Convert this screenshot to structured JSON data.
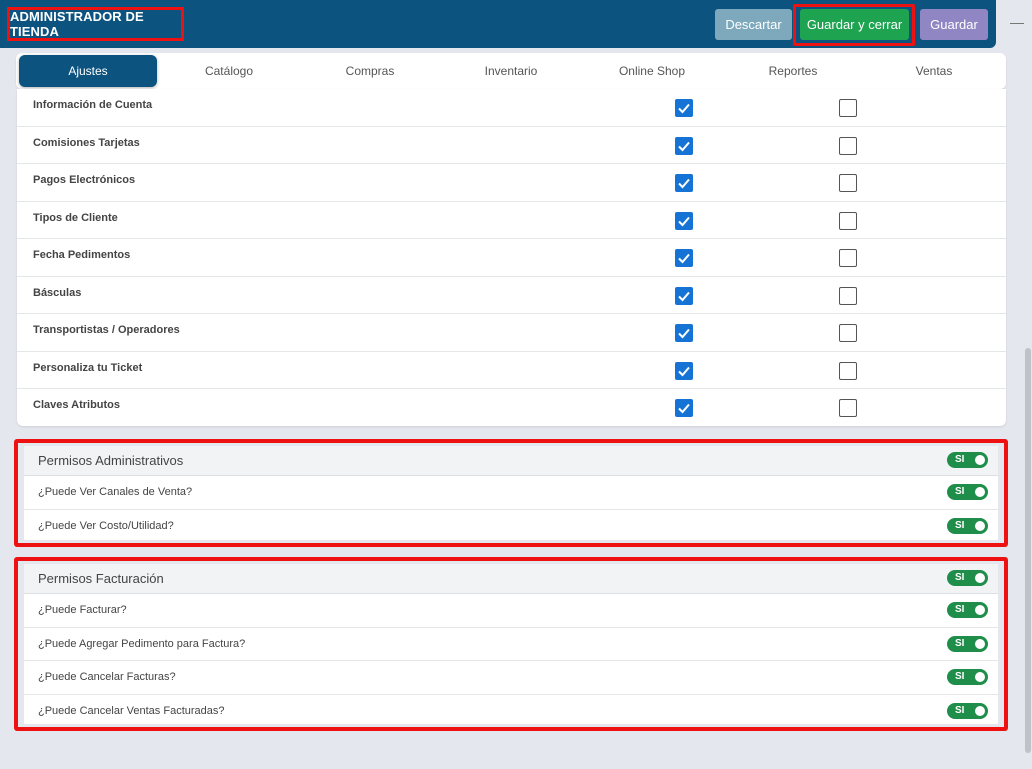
{
  "header": {
    "title": "ADMINISTRADOR DE TIENDA",
    "discard_label": "Descartar",
    "save_close_label": "Guardar y cerrar",
    "save_label": "Guardar"
  },
  "tabs": [
    {
      "label": "Ajustes",
      "active": true
    },
    {
      "label": "Catálogo",
      "active": false
    },
    {
      "label": "Compras",
      "active": false
    },
    {
      "label": "Inventario",
      "active": false
    },
    {
      "label": "Online Shop",
      "active": false
    },
    {
      "label": "Reportes",
      "active": false
    },
    {
      "label": "Ventas",
      "active": false
    }
  ],
  "permissions": [
    {
      "label": "Información de Cuenta",
      "col1": true,
      "col2": false
    },
    {
      "label": "Comisiones Tarjetas",
      "col1": true,
      "col2": false
    },
    {
      "label": "Pagos Electrónicos",
      "col1": true,
      "col2": false
    },
    {
      "label": "Tipos de Cliente",
      "col1": true,
      "col2": false
    },
    {
      "label": "Fecha Pedimentos",
      "col1": true,
      "col2": false
    },
    {
      "label": "Básculas",
      "col1": true,
      "col2": false
    },
    {
      "label": "Transportistas / Operadores",
      "col1": true,
      "col2": false
    },
    {
      "label": "Personaliza tu Ticket",
      "col1": true,
      "col2": false
    },
    {
      "label": "Claves Atributos",
      "col1": true,
      "col2": false
    }
  ],
  "admin_section": {
    "title": "Permisos Administrativos",
    "toggle": "SI",
    "items": [
      {
        "label": "¿Puede Ver Canales de Venta?",
        "toggle": "SI"
      },
      {
        "label": "¿Puede Ver Costo/Utilidad?",
        "toggle": "SI"
      }
    ]
  },
  "billing_section": {
    "title": "Permisos Facturación",
    "toggle": "SI",
    "items": [
      {
        "label": "¿Puede Facturar?",
        "toggle": "SI"
      },
      {
        "label": "¿Puede Agregar Pedimento para Factura?",
        "toggle": "SI"
      },
      {
        "label": "¿Puede Cancelar Facturas?",
        "toggle": "SI"
      },
      {
        "label": "¿Puede Cancelar Ventas Facturadas?",
        "toggle": "SI"
      }
    ]
  },
  "colors": {
    "header_bg": "#0d5380",
    "save_close": "#1ea351",
    "discard": "#7ea9bd",
    "save": "#8f86c3",
    "toggle_on": "#1e8e4a",
    "checkbox_checked": "#1673d6",
    "highlight": "#ee1111"
  }
}
